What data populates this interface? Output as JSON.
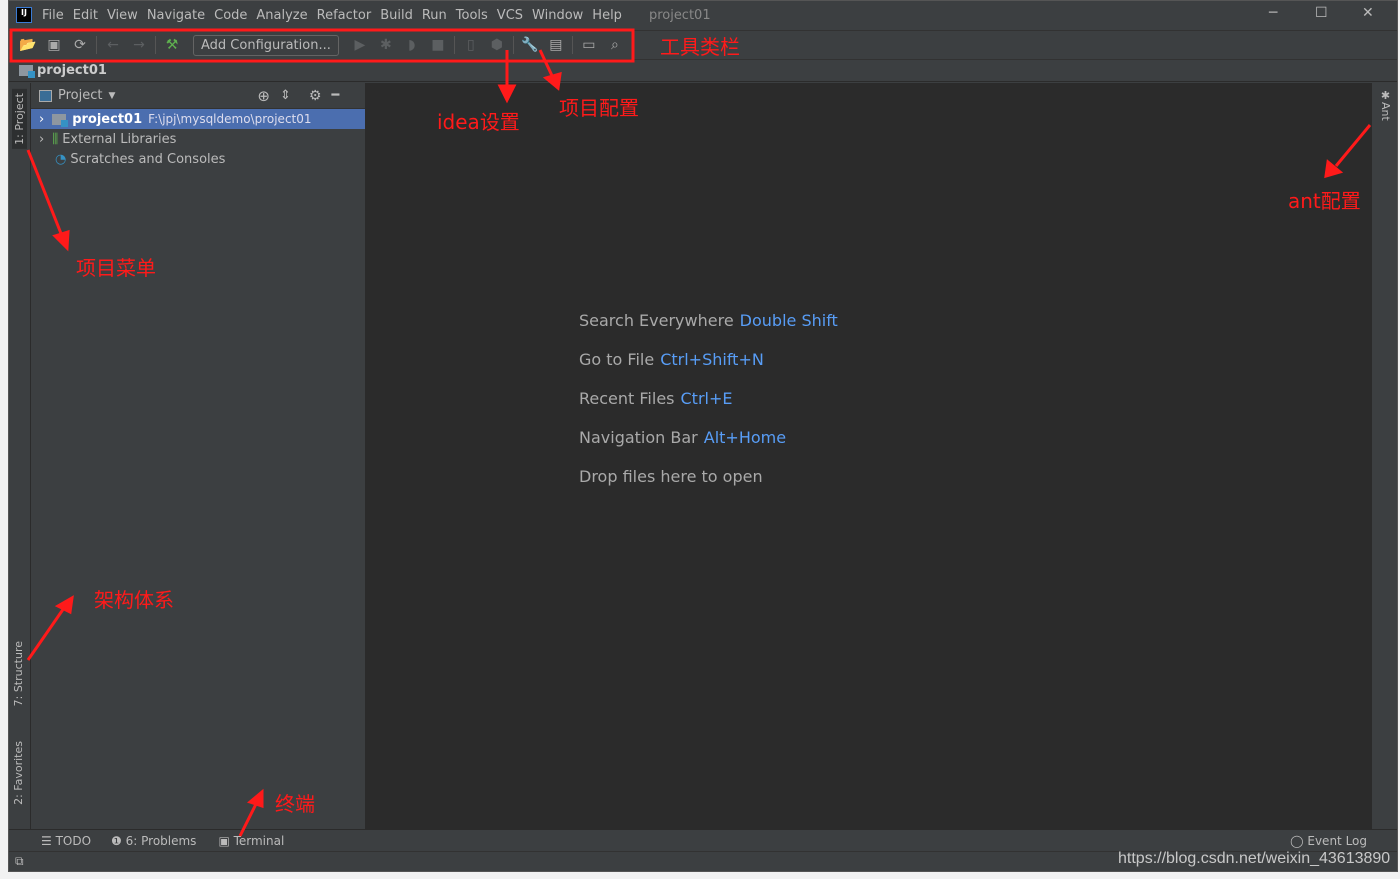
{
  "window": {
    "title": "project01",
    "logo": "IJ"
  },
  "menu": [
    "File",
    "Edit",
    "View",
    "Navigate",
    "Code",
    "Analyze",
    "Refactor",
    "Build",
    "Run",
    "Tools",
    "VCS",
    "Window",
    "Help"
  ],
  "toolbar": {
    "add_config": "Add Configuration..."
  },
  "navbar": {
    "project": "project01"
  },
  "left_tabs": {
    "project": "1: Project",
    "structure": "7: Structure",
    "favorites": "2: Favorites"
  },
  "panel": {
    "title": "Project",
    "tree": [
      {
        "name": "project01",
        "path": "F:\\jpj\\mysqldemo\\project01"
      },
      {
        "name": "External Libraries"
      },
      {
        "name": "Scratches and Consoles"
      }
    ]
  },
  "editor": {
    "hints": [
      {
        "label": "Search Everywhere",
        "key": "Double Shift"
      },
      {
        "label": "Go to File",
        "key": "Ctrl+Shift+N"
      },
      {
        "label": "Recent Files",
        "key": "Ctrl+E"
      },
      {
        "label": "Navigation Bar",
        "key": "Alt+Home"
      },
      {
        "label": "Drop files here to open",
        "key": ""
      }
    ]
  },
  "right_tabs": {
    "ant": "Ant"
  },
  "bottom_tabs": {
    "todo": "TODO",
    "problems": "6: Problems",
    "terminal": "Terminal",
    "event_log": "Event Log"
  },
  "annotations": {
    "toolbar": "工具类栏",
    "idea_settings": "idea设置",
    "project_config": "项目配置",
    "ant_config": "ant配置",
    "project_menu": "项目菜单",
    "structure": "架构体系",
    "terminal": "终端"
  },
  "watermark": "https://blog.csdn.net/weixin_43613890",
  "colors": {
    "annotation": "#ff1a1a",
    "selection": "#4b6eaf",
    "shortcut": "#589df6"
  }
}
